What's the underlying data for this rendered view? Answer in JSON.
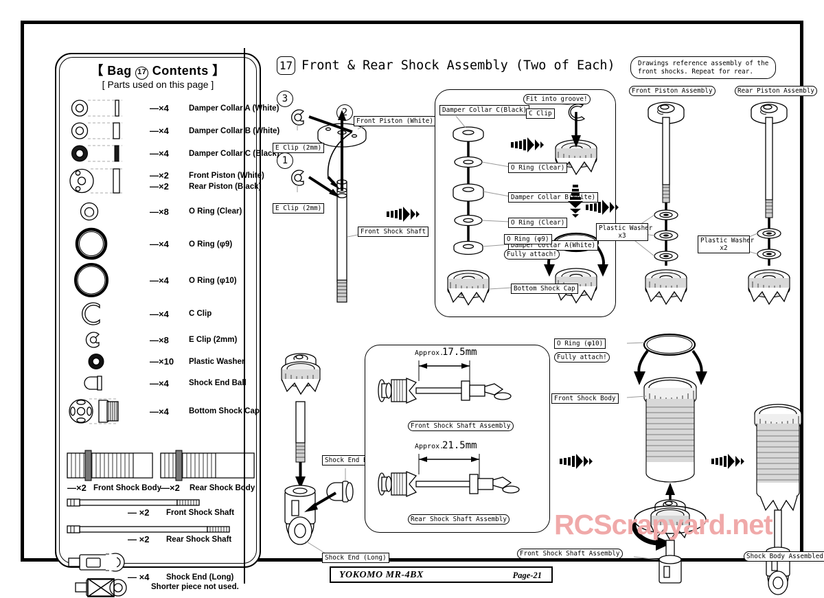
{
  "footer": {
    "brand": "YOKOMO MR-4BX",
    "page": "Page-21"
  },
  "watermark": "RCScrapyard.net",
  "parts_panel": {
    "title_prefix": "【 Bag ",
    "title_num": "17",
    "title_suffix": " Contents 】",
    "subtitle": "[ Parts used on this page ]",
    "items": [
      {
        "qty": "—×4",
        "name": "Damper Collar A (White)"
      },
      {
        "qty": "—×4",
        "name": "Damper Collar B (White)"
      },
      {
        "qty": "—×4",
        "name": "Damper Collar C (Black)"
      },
      {
        "qty": "—×2",
        "name": "Front Piston (White)"
      },
      {
        "qty": "—×2",
        "name": "Rear Piston (Black)"
      },
      {
        "qty": "—×8",
        "name": "O Ring (Clear)"
      },
      {
        "qty": "—×4",
        "name": "O Ring (φ9)"
      },
      {
        "qty": "—×4",
        "name": "O Ring (φ10)"
      },
      {
        "qty": "—×4",
        "name": "C Clip"
      },
      {
        "qty": "—×8",
        "name": "E Clip (2mm)"
      },
      {
        "qty": "—×10",
        "name": "Plastic Washer"
      },
      {
        "qty": "—×4",
        "name": "Shock End Ball"
      },
      {
        "qty": "—×4",
        "name": "Bottom Shock Cap"
      }
    ],
    "bodies": {
      "front_qty": "—×2",
      "front_name": "Front Shock Body",
      "rear_qty": "—×2",
      "rear_name": "Rear Shock Body"
    },
    "shafts": [
      {
        "qty": "— ×2",
        "name": "Front Shock Shaft"
      },
      {
        "qty": "— ×2",
        "name": "Rear Shock Shaft"
      },
      {
        "qty": "— ×4",
        "name": "Shock End (Long)"
      }
    ],
    "not_used": "Shorter piece not used."
  },
  "header": {
    "step_number": "17",
    "title": "Front & Rear Shock Assembly (Two of Each)",
    "note_line1": "Drawings reference assembly of the",
    "note_line2": "front shocks. Repeat for rear."
  },
  "shaft_diagram": {
    "step3": "3",
    "step2": "2",
    "step1": "1",
    "eclip_top": "E Clip (2mm)",
    "eclip_bottom": "E Clip (2mm)",
    "front_piston": "Front Piston (White)",
    "front_shaft": "Front Shock Shaft"
  },
  "stack_panel": {
    "collar_c": "Damper Collar C(Black)",
    "oring_clear_1": "O Ring (Clear)",
    "collar_b": "Damper Collar B(White)",
    "oring_clear_2": "O Ring (Clear)",
    "collar_a": "Damper Collar A(White)",
    "bottom_cap": "Bottom Shock Cap",
    "fit_groove": "Fit into groove!",
    "c_clip": "C Clip",
    "oring_phi9": "O Ring (φ9)",
    "fully_attach": "Fully attach!"
  },
  "piston_assemblies": {
    "front_title": "Front Piston Assembly",
    "rear_title": "Rear Piston Assembly",
    "front_washer": "Plastic Washer",
    "front_washer_qty": "x3",
    "rear_washer": "Plastic Washer",
    "rear_washer_qty": "x2"
  },
  "shock_end_diagram": {
    "ball_label": "Shock End Ball",
    "end_label": "Shock End  (Long)"
  },
  "measure_panel": {
    "front_dim_prefix": "Approx.",
    "front_dim": "17.5mm",
    "front_caption": "Front Shock Shaft Assembly",
    "rear_dim_prefix": "Approx.",
    "rear_dim": "21.5mm",
    "rear_caption": "Rear Shock Shaft Assembly"
  },
  "body_assembly": {
    "oring_phi10": "O Ring (φ10)",
    "fully_attach": "Fully attach!",
    "front_body": "Front Shock Body",
    "shaft_assembly": "Front Shock Shaft Assembly",
    "assembled": "Shock Body Assembled!"
  }
}
